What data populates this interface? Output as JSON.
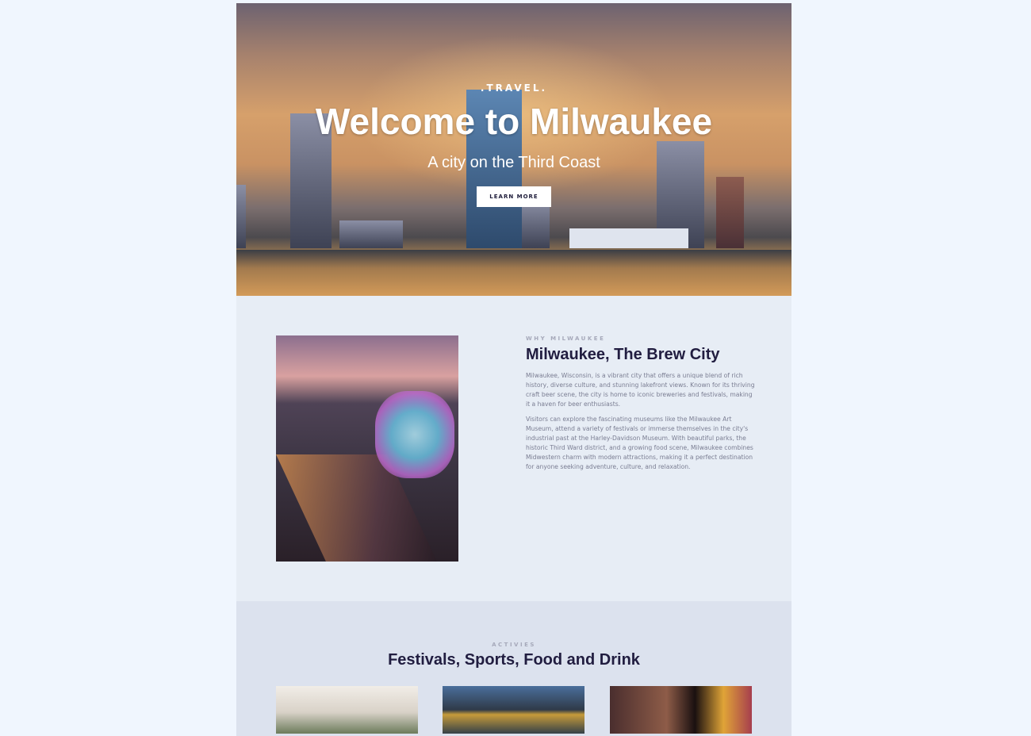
{
  "hero": {
    "eyebrow": ".TRAVEL.",
    "title": "Welcome to Milwaukee",
    "subtitle": "A city on the Third Coast",
    "button_label": "LEARN MORE"
  },
  "why": {
    "kicker": "WHY MILWAUKEE",
    "title": "Milwaukee, The Brew City",
    "paragraphs": [
      "Milwaukee, Wisconsin, is a vibrant city that offers a unique blend of rich history, diverse culture, and stunning lakefront views. Known for its thriving craft beer scene, the city is home to iconic breweries and festivals, making it a haven for beer enthusiasts.",
      "Visitors can explore the fascinating museums like the Milwaukee Art Museum, attend a variety of festivals or immerse themselves in the city's industrial past at the Harley-Davidson Museum. With beautiful parks, the historic Third Ward district, and a growing food scene, Milwaukee combines Midwestern charm with modern attractions, making it a perfect destination for anyone seeking adventure, culture, and relaxation."
    ]
  },
  "activities": {
    "kicker": "ACTIVIES",
    "title": "Festivals, Sports, Food and Drink"
  }
}
